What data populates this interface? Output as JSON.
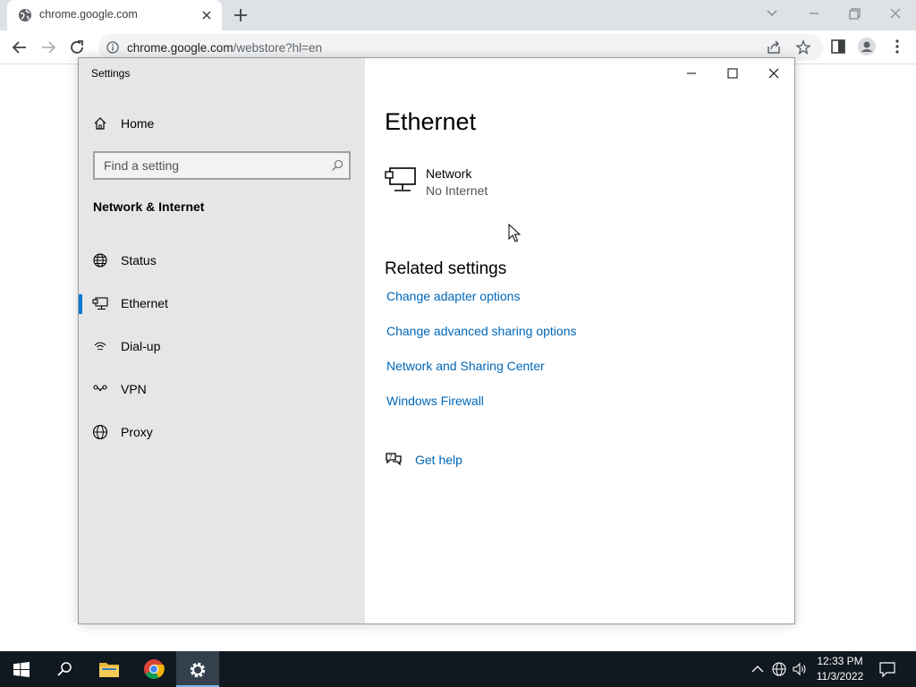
{
  "browser": {
    "tab_title": "chrome.google.com",
    "url_host": "chrome.google.com",
    "url_rest": "/webstore?hl=en"
  },
  "settings": {
    "window_title": "Settings",
    "home_label": "Home",
    "search_placeholder": "Find a setting",
    "section_title": "Network & Internet",
    "nav": [
      {
        "label": "Status",
        "icon": "globe-status-icon"
      },
      {
        "label": "Ethernet",
        "icon": "ethernet-icon",
        "selected": true
      },
      {
        "label": "Dial-up",
        "icon": "dialup-icon"
      },
      {
        "label": "VPN",
        "icon": "vpn-icon"
      },
      {
        "label": "Proxy",
        "icon": "globe-icon"
      }
    ],
    "page_title": "Ethernet",
    "network": {
      "name": "Network",
      "status": "No Internet"
    },
    "related_title": "Related settings",
    "related_links": [
      "Change adapter options",
      "Change advanced sharing options",
      "Network and Sharing Center",
      "Windows Firewall"
    ],
    "help_label": "Get help",
    "accent_color": "#0078d4",
    "link_color": "#0067b8"
  },
  "taskbar": {
    "time": "12:33 PM",
    "date": "11/3/2022"
  }
}
